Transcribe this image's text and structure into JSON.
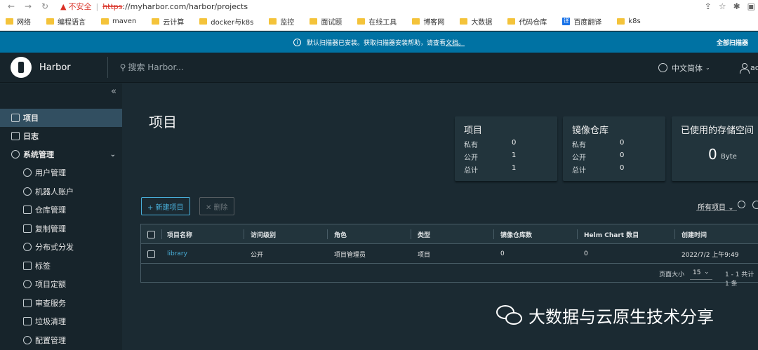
{
  "browser": {
    "insecure_label": "不安全",
    "url_scheme": "https",
    "url_rest": "://myharbor.com/harbor/projects",
    "bookmarks": [
      "网络",
      "编程语言",
      "maven",
      "云计算",
      "docker与k8s",
      "监控",
      "面试题",
      "在线工具",
      "博客网",
      "大数据",
      "代码仓库",
      "百度翻译",
      "k8s"
    ],
    "translate_badge": "译"
  },
  "banner": {
    "message": "默认扫描器已安装。获取扫描器安装帮助，请查看",
    "link": "文档。",
    "action": "全部扫描器"
  },
  "header": {
    "brand": "Harbor",
    "search_placeholder": "搜索 Harbor...",
    "language": "中文简体",
    "user": "ac"
  },
  "sidebar": {
    "collapse": "«",
    "items": [
      {
        "label": "项目"
      },
      {
        "label": "日志"
      },
      {
        "label": "系统管理"
      },
      {
        "label": "用户管理"
      },
      {
        "label": "机器人账户"
      },
      {
        "label": "仓库管理"
      },
      {
        "label": "复制管理"
      },
      {
        "label": "分布式分发"
      },
      {
        "label": "标签"
      },
      {
        "label": "项目定额"
      },
      {
        "label": "审查服务"
      },
      {
        "label": "垃圾清理"
      },
      {
        "label": "配置管理"
      }
    ]
  },
  "main": {
    "title": "项目",
    "cards": {
      "projects": {
        "title": "项目",
        "private_label": "私有",
        "private": "0",
        "public_label": "公开",
        "public": "1",
        "total_label": "总计",
        "total": "1"
      },
      "repos": {
        "title": "镜像仓库",
        "private_label": "私有",
        "private": "0",
        "public_label": "公开",
        "public": "0",
        "total_label": "总计",
        "total": "0"
      },
      "storage": {
        "title": "已使用的存储空间",
        "value": "0",
        "unit": "Byte"
      }
    },
    "new_project": "+ 新建项目",
    "delete": "✕ 删除",
    "filter": "所有项目",
    "table": {
      "headers": [
        "项目名称",
        "访问级别",
        "角色",
        "类型",
        "镜像仓库数",
        "Helm Chart 数目",
        "创建时间"
      ],
      "rows": [
        [
          "library",
          "公开",
          "项目管理员",
          "项目",
          "0",
          "0",
          "2022/7/2 上午9:49"
        ]
      ],
      "page_size_label": "页面大小",
      "page_size": "15",
      "total": "1 - 1 共计 1 条"
    }
  },
  "watermark": "大数据与云原生技术分享"
}
